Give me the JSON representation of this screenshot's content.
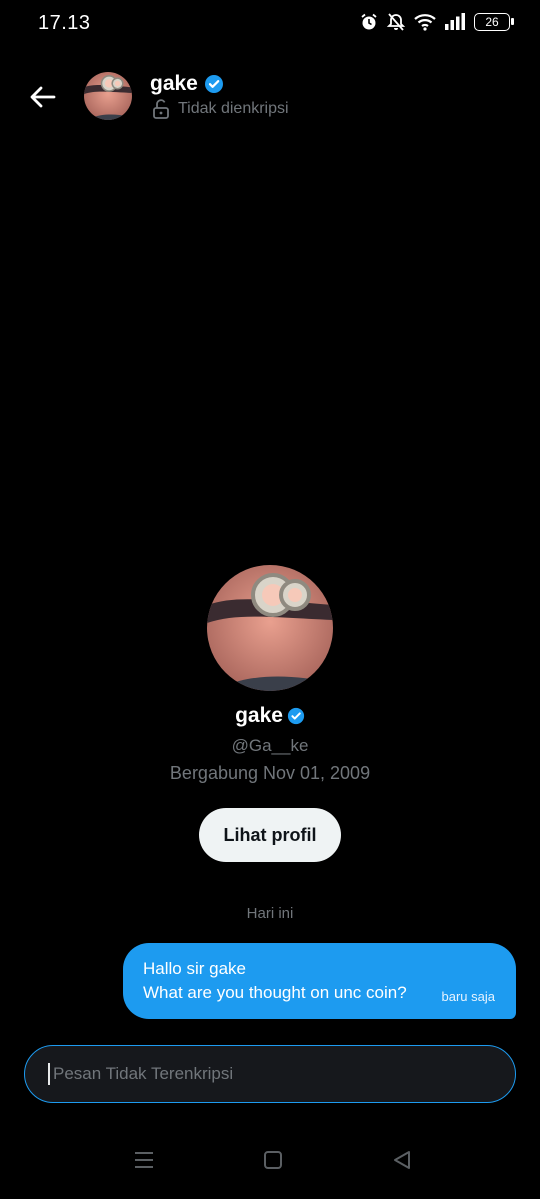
{
  "status_bar": {
    "time": "17.13",
    "battery": "26"
  },
  "header": {
    "name": "gake",
    "subtitle": "Tidak dienkripsi"
  },
  "profile": {
    "name": "gake",
    "handle": "@Ga__ke",
    "joined": "Bergabung Nov 01, 2009",
    "view_button": "Lihat profil"
  },
  "conversation": {
    "date_label": "Hari ini",
    "messages": [
      {
        "lines": [
          "Hallo sir gake",
          "What are you thought on unc coin?"
        ],
        "time": "baru saja"
      }
    ]
  },
  "composer": {
    "placeholder": "Pesan Tidak Terenkripsi"
  },
  "colors": {
    "accent": "#1d9bf0",
    "background": "#000000",
    "muted": "#71767b"
  },
  "icons": [
    "alarm-icon",
    "mute-icon",
    "wifi-icon",
    "signal-icon",
    "battery-icon",
    "back-arrow-icon",
    "verified-badge-icon",
    "unlock-icon",
    "menu-nav-icon",
    "home-nav-icon",
    "back-nav-icon"
  ]
}
